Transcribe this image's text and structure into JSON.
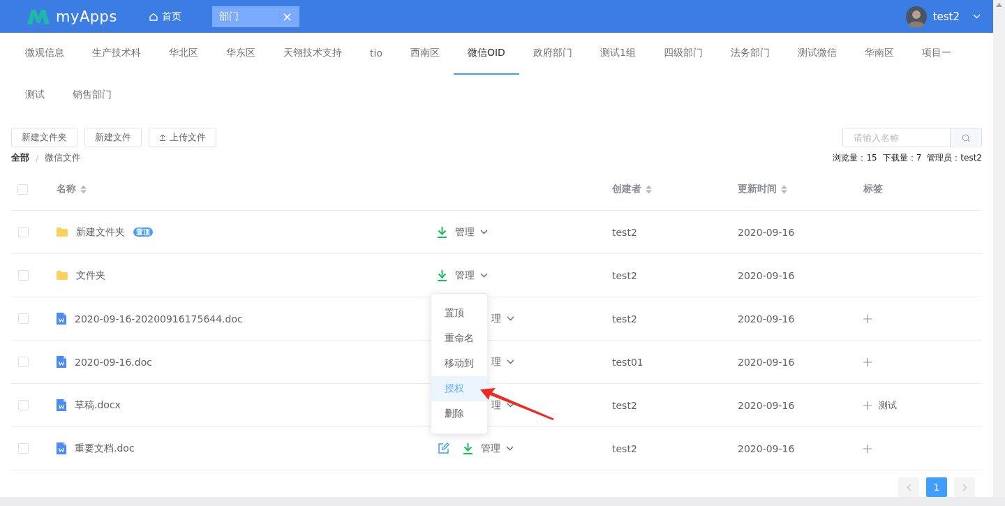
{
  "header": {
    "logo": "myApps",
    "nav": [
      {
        "label": "首页",
        "kind": "home",
        "selected": false
      },
      {
        "label": "部门",
        "kind": "closable",
        "selected": true,
        "close": "×"
      }
    ],
    "user": {
      "name": "test2"
    }
  },
  "dept_tabs": [
    {
      "label": "微观信息",
      "selected": false
    },
    {
      "label": "生产技术科",
      "selected": false
    },
    {
      "label": "华北区",
      "selected": false
    },
    {
      "label": "华东区",
      "selected": false
    },
    {
      "label": "天翎技术支持",
      "selected": false
    },
    {
      "label": "tio",
      "selected": false
    },
    {
      "label": "西南区",
      "selected": false
    },
    {
      "label": "微信OID",
      "selected": true
    },
    {
      "label": "政府部门",
      "selected": false
    },
    {
      "label": "测试1组",
      "selected": false
    },
    {
      "label": "四级部门",
      "selected": false
    },
    {
      "label": "法务部门",
      "selected": false
    },
    {
      "label": "测试微信",
      "selected": false
    },
    {
      "label": "华南区",
      "selected": false
    },
    {
      "label": "项目一",
      "selected": false
    },
    {
      "label": "测试",
      "selected": false
    },
    {
      "label": "销售部门",
      "selected": false
    }
  ],
  "toolbar": {
    "buttons": [
      {
        "label": "新建文件夹",
        "kind": "plain"
      },
      {
        "label": "新建文件",
        "kind": "plain"
      },
      {
        "label": "上传文件",
        "kind": "upload"
      }
    ],
    "search": {
      "placeholder": "请输入名称"
    }
  },
  "breadcrumb": {
    "items": [
      "全部",
      "微信文件"
    ],
    "separator": "/"
  },
  "stats": [
    "浏览量：15",
    "下载量：7",
    "管理员：test2"
  ],
  "table": {
    "all_checked": false,
    "columns": [
      {
        "label": "名称",
        "sortable": true
      },
      {
        "label": "创建者",
        "sortable": true
      },
      {
        "label": "更新时间",
        "sortable": true
      },
      {
        "label": "标签",
        "sortable": false
      }
    ],
    "rows": [
      {
        "kind": "folder",
        "name": "新建文件夹",
        "badge": "置顶",
        "checked": false,
        "actions": {
          "edit": false,
          "download": true,
          "manage": "管理",
          "covered": false
        },
        "creator": "test2",
        "updated": "2020-09-16",
        "addable": false,
        "tags": []
      },
      {
        "kind": "folder",
        "name": "文件夹",
        "checked": false,
        "actions": {
          "edit": false,
          "download": true,
          "manage": "管理",
          "covered": false
        },
        "creator": "test2",
        "updated": "2020-09-16",
        "addable": false,
        "tags": []
      },
      {
        "kind": "doc",
        "name": "2020-09-16-20200916175644.doc",
        "checked": false,
        "actions": {
          "edit": false,
          "download": false,
          "manage": "理",
          "covered": true
        },
        "creator": "test2",
        "updated": "2020-09-16",
        "addable": true,
        "tags": []
      },
      {
        "kind": "doc",
        "name": "2020-09-16.doc",
        "checked": false,
        "actions": {
          "edit": false,
          "download": false,
          "manage": "理",
          "covered": true
        },
        "creator": "test01",
        "updated": "2020-09-16",
        "addable": true,
        "tags": []
      },
      {
        "kind": "doc",
        "name": "草稿.docx",
        "checked": false,
        "actions": {
          "edit": false,
          "download": false,
          "manage": "理",
          "covered": true
        },
        "creator": "test2",
        "updated": "2020-09-16",
        "addable": true,
        "tags": [
          "测试"
        ]
      },
      {
        "kind": "doc",
        "name": "重要文档.doc",
        "checked": false,
        "actions": {
          "edit": true,
          "download": true,
          "manage": "管理",
          "covered": false
        },
        "creator": "test2",
        "updated": "2020-09-16",
        "addable": true,
        "tags": []
      }
    ]
  },
  "menu": {
    "items": [
      {
        "label": "置顶",
        "selected": false
      },
      {
        "label": "重命名",
        "selected": false
      },
      {
        "label": "移动到",
        "selected": false
      },
      {
        "label": "授权",
        "selected": true
      },
      {
        "label": "删除",
        "selected": false
      }
    ]
  },
  "pagination": {
    "prev_disabled": true,
    "next_disabled": true,
    "pages": [
      {
        "label": "1",
        "selected": true
      }
    ]
  }
}
